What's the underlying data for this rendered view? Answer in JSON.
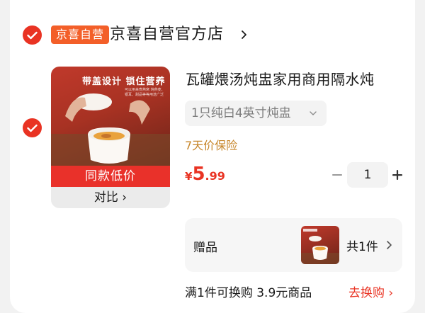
{
  "shop": {
    "badge": "京喜自营",
    "name": "京喜自营官方店"
  },
  "item": {
    "thumbnail": {
      "headline": "带盖设计  锁住营养",
      "subtext": "可以用来煮燕窝 炖燕麦、银耳、甜品等等用途广泛",
      "banner": "同款低价",
      "compare": "对比 ›"
    },
    "title": "瓦罐煨汤炖盅家用商用隔水炖",
    "variant": "1只纯白4英寸炖盅",
    "insurance": "7天价保险",
    "price": {
      "currency": "¥",
      "integer": "5",
      "decimal": ".99"
    },
    "quantity": "1"
  },
  "gift": {
    "label": "赠品",
    "count": "共1件"
  },
  "promo": {
    "text": "满1件可换购 3.9元商品",
    "link": "去换购 ›"
  },
  "colors": {
    "accent": "#e93323",
    "badge": "#f35f29",
    "insurance": "#c7862a"
  }
}
